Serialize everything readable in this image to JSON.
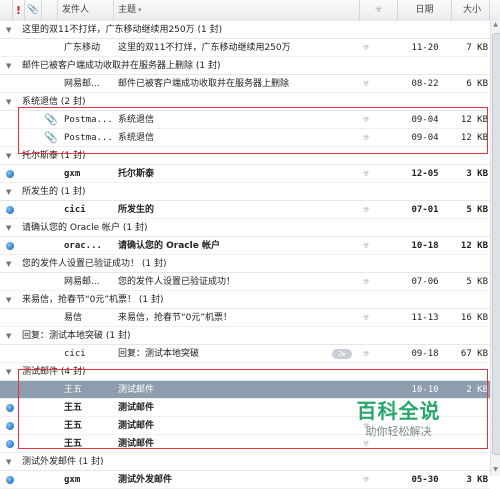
{
  "header": {
    "flag": "!",
    "attachment": "📎",
    "sender": "发件人",
    "subject": "主题",
    "junk": "☣",
    "date": "日期",
    "size": "大小",
    "sort_chevron": "▾"
  },
  "rows": [
    {
      "kind": "group",
      "title": "这里的双11不打烊，广东移动继续用250万  (1 封)"
    },
    {
      "kind": "mail",
      "sender": "广东移动",
      "subject": "这里的双11不打烊，广东移动继续用250万",
      "date": "11-20",
      "size": "7 KB",
      "bold": false,
      "dot": false,
      "clip": false
    },
    {
      "kind": "group",
      "title": "邮件已被客户端成功收取并在服务器上删除  (1 封)"
    },
    {
      "kind": "mail",
      "sender": "网易邮...",
      "subject": "邮件已被客户端成功收取并在服务器上删除",
      "date": "08-22",
      "size": "6 KB",
      "bold": false,
      "dot": false,
      "clip": false
    },
    {
      "kind": "group",
      "title": "系统退信  (2 封)"
    },
    {
      "kind": "mail",
      "sender": "Postma...",
      "subject": "系统退信",
      "date": "09-04",
      "size": "12 KB",
      "bold": false,
      "dot": false,
      "clip": true
    },
    {
      "kind": "mail",
      "sender": "Postma...",
      "subject": "系统退信",
      "date": "09-04",
      "size": "12 KB",
      "bold": false,
      "dot": false,
      "clip": true
    },
    {
      "kind": "group",
      "title": "托尔斯泰  (1 封)"
    },
    {
      "kind": "mail",
      "sender": "gxm",
      "subject": "托尔斯泰",
      "date": "12-05",
      "size": "3 KB",
      "bold": true,
      "dot": true,
      "clip": false
    },
    {
      "kind": "group",
      "title": "所发生的  (1 封)"
    },
    {
      "kind": "mail",
      "sender": "cici",
      "subject": "所发生的",
      "date": "07-01",
      "size": "5 KB",
      "bold": true,
      "dot": true,
      "clip": false
    },
    {
      "kind": "group",
      "title": "请确认您的 Oracle 帐户  (1 封)"
    },
    {
      "kind": "mail",
      "sender": "orac...",
      "subject": "请确认您的 Oracle 帐户",
      "date": "10-18",
      "size": "12 KB",
      "bold": true,
      "dot": true,
      "clip": false
    },
    {
      "kind": "group",
      "title": "您的发件人设置已验证成功！  (1 封)"
    },
    {
      "kind": "mail",
      "sender": "网易邮...",
      "subject": "您的发件人设置已验证成功！",
      "date": "07-06",
      "size": "5 KB",
      "bold": false,
      "dot": false,
      "clip": false
    },
    {
      "kind": "group",
      "title": "来易信，抢春节“0元”机票！  (1 封)"
    },
    {
      "kind": "mail",
      "sender": "易信",
      "subject": "来易信，抢春节“0元”机票！",
      "date": "11-13",
      "size": "16 KB",
      "bold": false,
      "dot": false,
      "clip": false
    },
    {
      "kind": "group",
      "title": "回复：测试本地突破  (1 封)"
    },
    {
      "kind": "mail",
      "sender": "cici",
      "subject": "回复：测试本地突破",
      "date": "09-18",
      "size": "67 KB",
      "bold": false,
      "dot": false,
      "clip": false,
      "badge": "2▸"
    },
    {
      "kind": "group",
      "title": "测试邮件  (4 封)"
    },
    {
      "kind": "mail",
      "sender": "王五",
      "subject": "测试邮件",
      "date": "10-10",
      "size": "2 KB",
      "bold": false,
      "dot": false,
      "clip": false,
      "selected": true
    },
    {
      "kind": "mail",
      "sender": "王五",
      "subject": "测试邮件",
      "date": "",
      "size": "",
      "bold": true,
      "dot": true,
      "clip": false
    },
    {
      "kind": "mail",
      "sender": "王五",
      "subject": "测试邮件",
      "date": "",
      "size": "",
      "bold": true,
      "dot": true,
      "clip": false
    },
    {
      "kind": "mail",
      "sender": "王五",
      "subject": "测试邮件",
      "date": "",
      "size": "",
      "bold": true,
      "dot": true,
      "clip": false
    },
    {
      "kind": "group",
      "title": "测试外发邮件  (1 封)"
    },
    {
      "kind": "mail",
      "sender": "gxm",
      "subject": "测试外发邮件",
      "date": "05-30",
      "size": "3 KB",
      "bold": true,
      "dot": true,
      "clip": false
    }
  ],
  "watermark": {
    "line1": "百科全说",
    "line2": "助你轻松解决"
  },
  "scroll": {
    "up": "▲",
    "down": "▼"
  },
  "colors": {
    "selected_row": "#8c9dad",
    "highlight_box": "#e8323c",
    "unread_dot": "#2c7bd0",
    "watermark": "#27a86a"
  }
}
